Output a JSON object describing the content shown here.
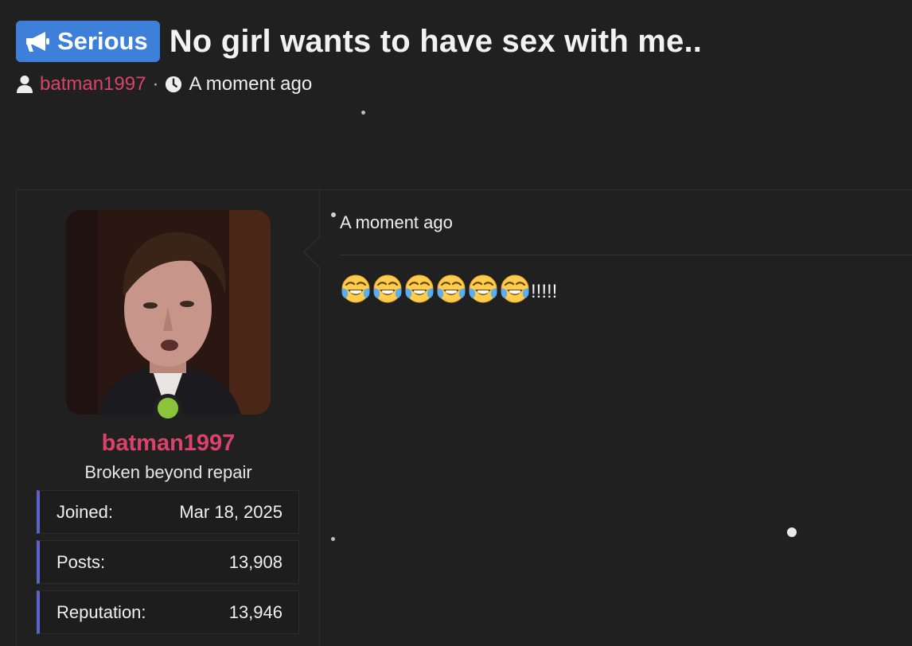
{
  "thread": {
    "prefix": "Serious",
    "title": "No girl wants to have sex with me..",
    "author": "batman1997",
    "separator": "·",
    "time": "A moment ago"
  },
  "post": {
    "user": {
      "name": "batman1997",
      "title": "Broken beyond repair",
      "online": true,
      "stats": [
        {
          "label": "Joined:",
          "value": "Mar 18, 2025"
        },
        {
          "label": "Posts:",
          "value": "13,908"
        },
        {
          "label": "Reputation:",
          "value": "13,946"
        }
      ]
    },
    "time": "A moment ago",
    "emoji": "face-with-tears-of-joy",
    "emoji_count": 6,
    "body_suffix": "!!!!!"
  },
  "colors": {
    "background": "#202020",
    "prefix_badge": "#3d7fd9",
    "username": "#d9436b",
    "online": "#8bc33a",
    "stat_accent": "#5b63c9"
  }
}
